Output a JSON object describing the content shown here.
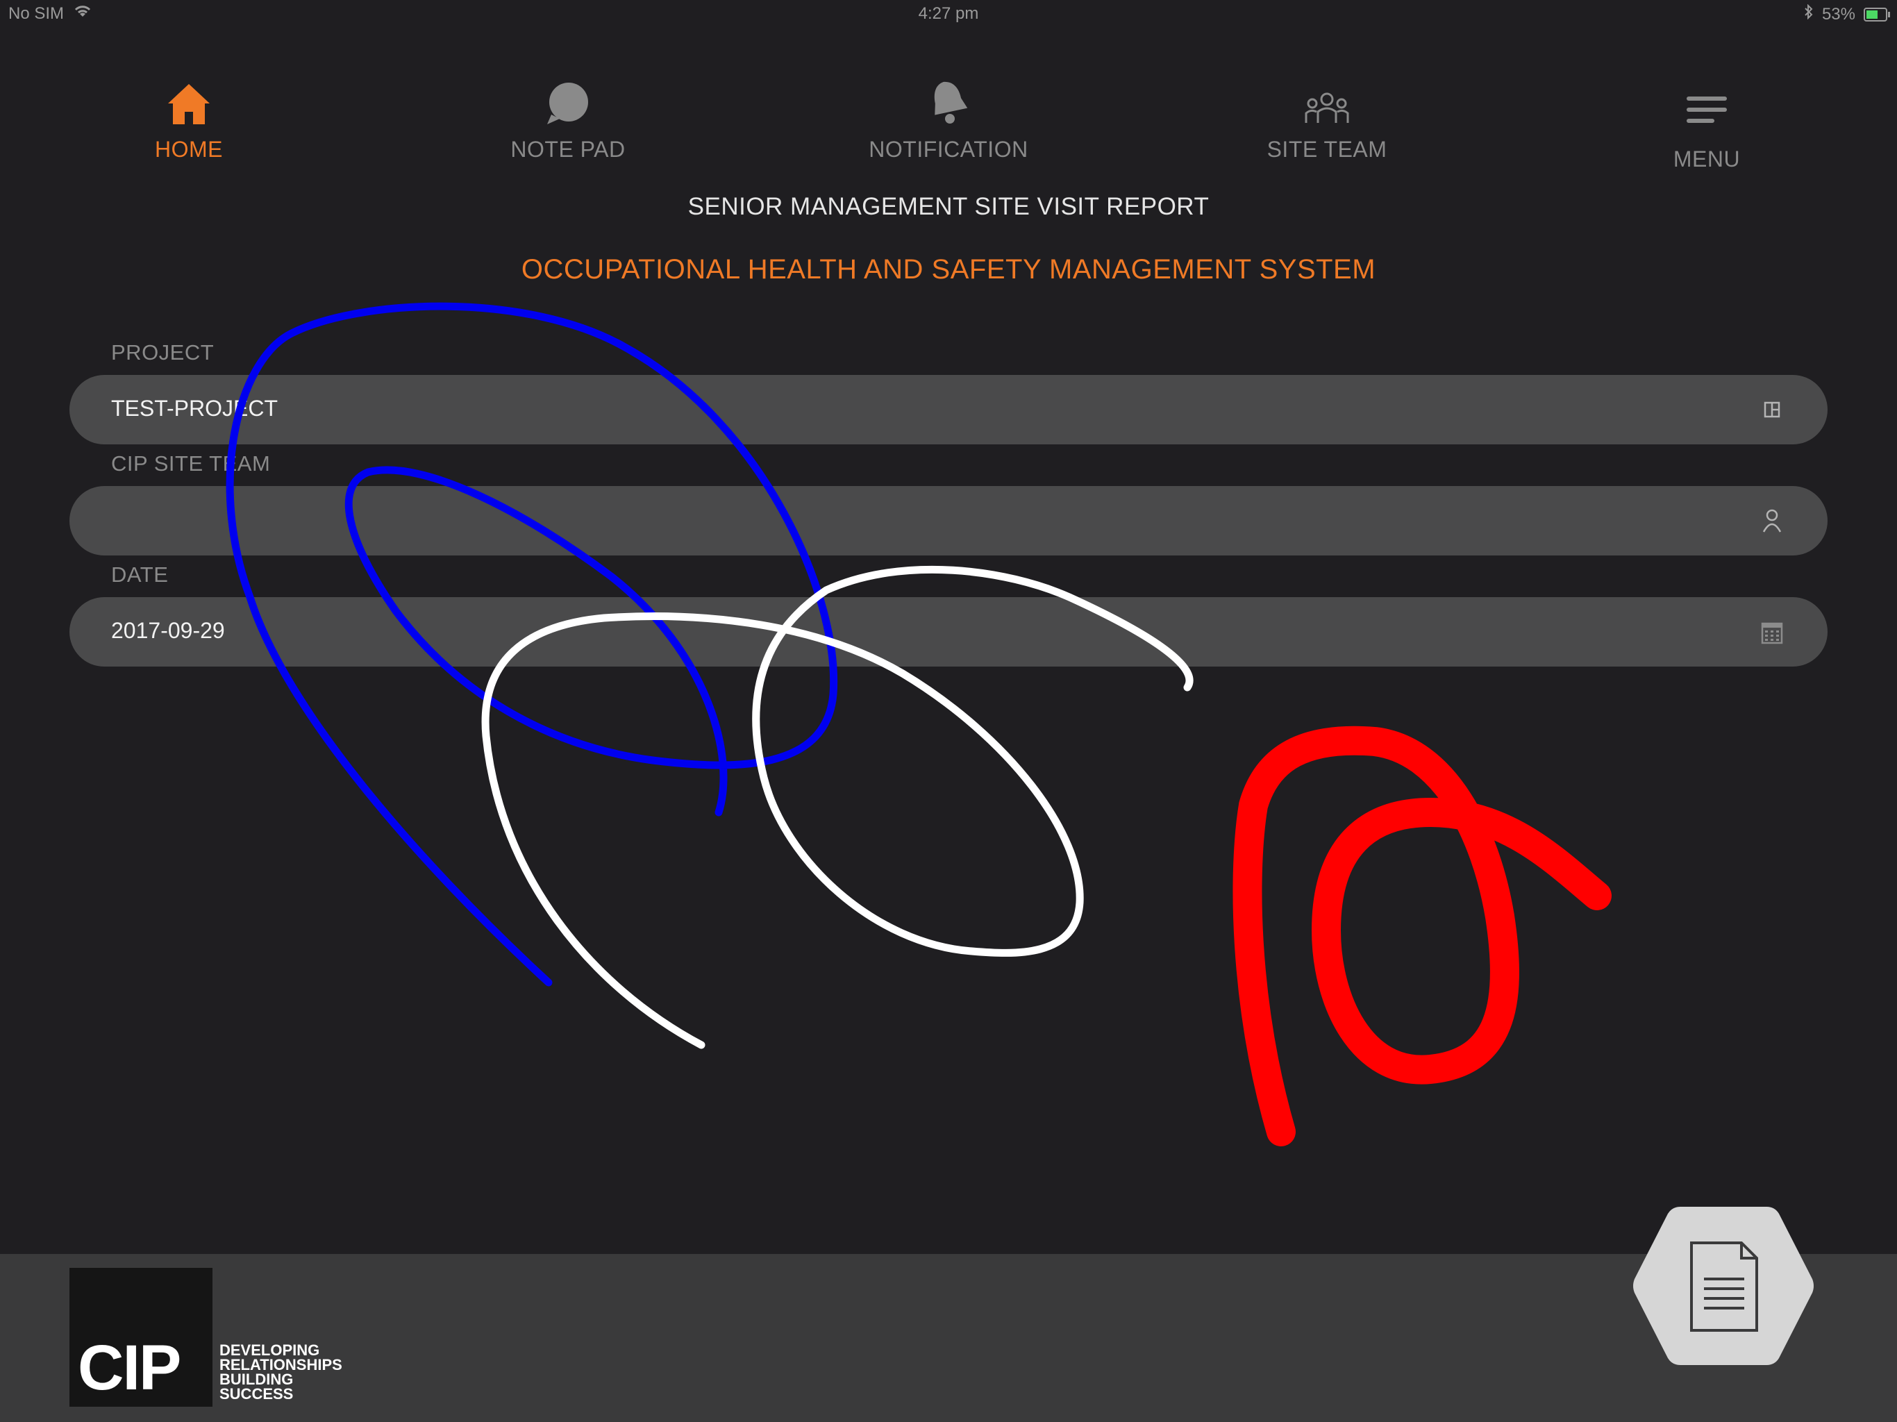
{
  "status_bar": {
    "carrier": "No SIM",
    "time": "4:27 pm",
    "battery": "53%",
    "battery_level": 0.53
  },
  "nav": {
    "items": [
      {
        "label": "HOME",
        "icon": "home-icon",
        "active": true
      },
      {
        "label": "NOTE PAD",
        "icon": "note-pad-icon",
        "active": false
      },
      {
        "label": "NOTIFICATION",
        "icon": "bell-icon",
        "active": false
      },
      {
        "label": "SITE TEAM",
        "icon": "team-icon",
        "active": false
      },
      {
        "label": "MENU",
        "icon": "hamburger-menu-icon",
        "active": false
      }
    ]
  },
  "header": {
    "title": "SENIOR MANAGEMENT SITE VISIT REPORT",
    "subtitle": "OCCUPATIONAL HEALTH AND SAFETY MANAGEMENT SYSTEM"
  },
  "form": {
    "project": {
      "label": "PROJECT",
      "value": "TEST-PROJECT",
      "icon": "list-picker-icon"
    },
    "site_team": {
      "label": "CIP SITE TEAM",
      "value": "",
      "icon": "person-icon"
    },
    "date": {
      "label": "DATE",
      "value": "2017-09-29",
      "icon": "calendar-icon"
    }
  },
  "footer": {
    "logo": "CIP",
    "tagline": [
      "DEVELOPING",
      "RELATIONSHIPS",
      "BUILDING",
      "SUCCESS"
    ],
    "report_button_icon": "document-icon"
  },
  "colors": {
    "accent": "#f07a26",
    "background": "#1f1e21",
    "field": "#4a4a4b",
    "footer": "#3a3a3b",
    "scribble_blue": "#0000f0",
    "scribble_white": "#ffffff",
    "scribble_red": "#ff0000"
  }
}
